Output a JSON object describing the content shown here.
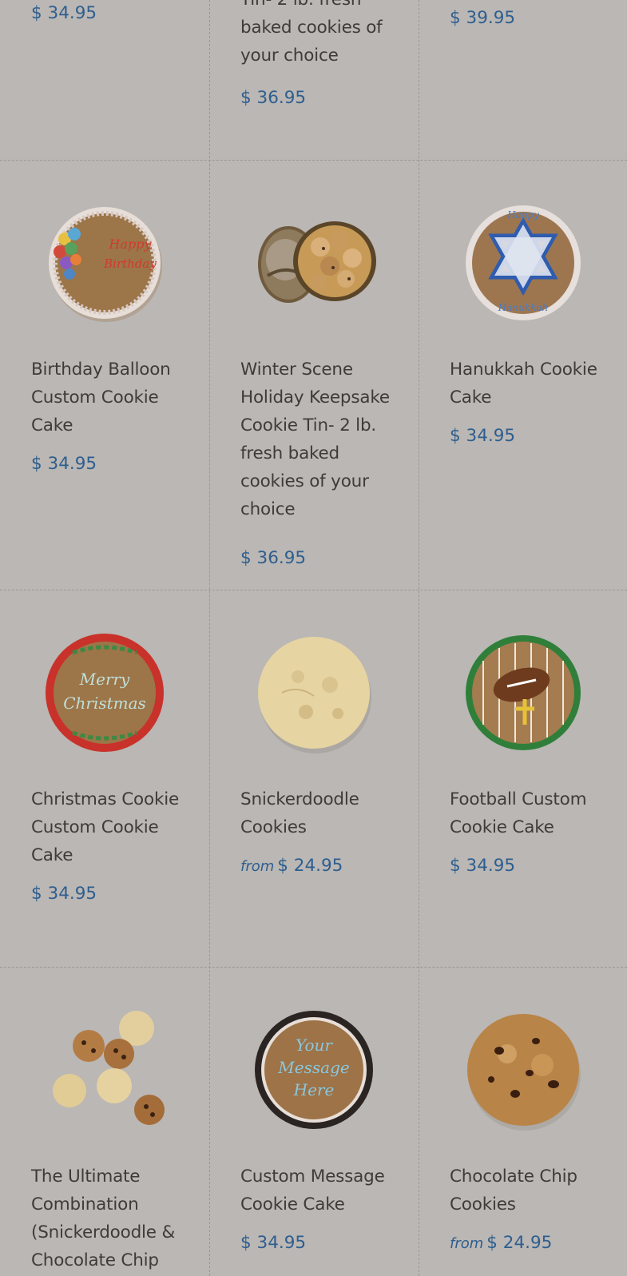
{
  "top_row": {
    "col1_price": "$ 34.95",
    "col2_name_lines": "Tin- 2 lb. fresh baked cookies of your choice",
    "col2_price": "$ 36.95",
    "col3_price": "$ 39.95"
  },
  "products": [
    {
      "name": "Birthday Balloon Custom Cookie Cake",
      "from": "",
      "price": "$ 34.95",
      "image": "birthday-balloon-cookie-cake-image"
    },
    {
      "name": "Winter Scene Holiday Keepsake Cookie Tin- 2 lb. fresh baked cookies of your choice",
      "from": "",
      "price": "$ 36.95",
      "image": "winter-scene-cookie-tin-image"
    },
    {
      "name": "Hanukkah Cookie Cake",
      "from": "",
      "price": "$ 34.95",
      "image": "hanukkah-cookie-cake-image"
    },
    {
      "name": "Christmas Cookie Custom Cookie Cake",
      "from": "",
      "price": "$ 34.95",
      "image": "christmas-cookie-cake-image"
    },
    {
      "name": "Snickerdoodle Cookies",
      "from": "from",
      "price": "$ 24.95",
      "image": "snickerdoodle-cookie-image"
    },
    {
      "name": "Football Custom Cookie Cake",
      "from": "",
      "price": "$ 34.95",
      "image": "football-cookie-cake-image"
    },
    {
      "name": "The Ultimate Combination (Snickerdoodle & Chocolate Chip",
      "from": "",
      "price": "",
      "image": "combination-cookies-image"
    },
    {
      "name": "Custom Message Cookie Cake",
      "from": "",
      "price": "$ 34.95",
      "image": "custom-message-cookie-cake-image"
    },
    {
      "name": "Chocolate Chip Cookies",
      "from": "from",
      "price": "$ 24.95",
      "image": "chocolate-chip-cookie-image"
    }
  ],
  "image_text": {
    "birthday": "Happy Birthday",
    "hanukkah_top": "Happy",
    "hanukkah_bottom": "Hanukkah",
    "christmas_1": "Merry",
    "christmas_2": "Christmas",
    "custom_1": "Your",
    "custom_2": "Message",
    "custom_3": "Here"
  },
  "colors": {
    "background": "#bab7b4",
    "price": "#2e5e8f",
    "text": "#3e3b38"
  }
}
